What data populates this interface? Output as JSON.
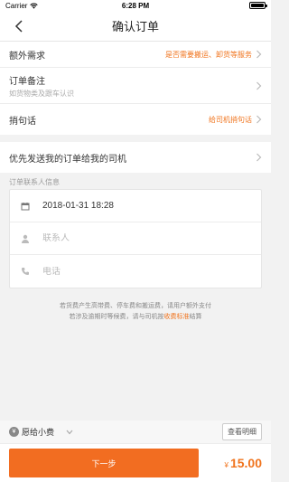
{
  "status_bar": {
    "carrier": "Carrier",
    "time": "6:28 PM"
  },
  "nav": {
    "title": "确认订单"
  },
  "options": {
    "extra_needs": {
      "label": "额外需求",
      "value": "是否需要搬运、卸货等服务"
    },
    "order_note": {
      "label": "订单备注",
      "sub": "如货物类及跟车认识"
    },
    "bring_message": {
      "label": "捎句话",
      "value": "给司机捎句话"
    }
  },
  "priority": {
    "label": "优先发送我的订单给我的司机"
  },
  "contact": {
    "section_title": "订单联系人信息",
    "datetime": "2018-01-31 18:28",
    "name_placeholder": "联系人",
    "phone_placeholder": "电话"
  },
  "notice": {
    "line1": "若货费产生高带费、停车费和搬运费，请用户额外支付",
    "line2_prefix": "若涉及逾期时等候费，请与司机按",
    "link": "收费标准",
    "line2_suffix": "结算"
  },
  "bottom": {
    "tip_symbol": "¥",
    "tip_label": "愿给小费",
    "detail_button": "查看明细",
    "next_button": "下一步",
    "currency": "¥",
    "price": "15.00"
  },
  "icons": {
    "back": "chevron-left-icon",
    "calendar": "calendar-icon",
    "person": "person-icon",
    "phone": "phone-icon",
    "wifi": "wifi-icon",
    "battery": "battery-icon"
  },
  "colors": {
    "accent": "#f26d21",
    "accent_text": "#f0741e"
  }
}
